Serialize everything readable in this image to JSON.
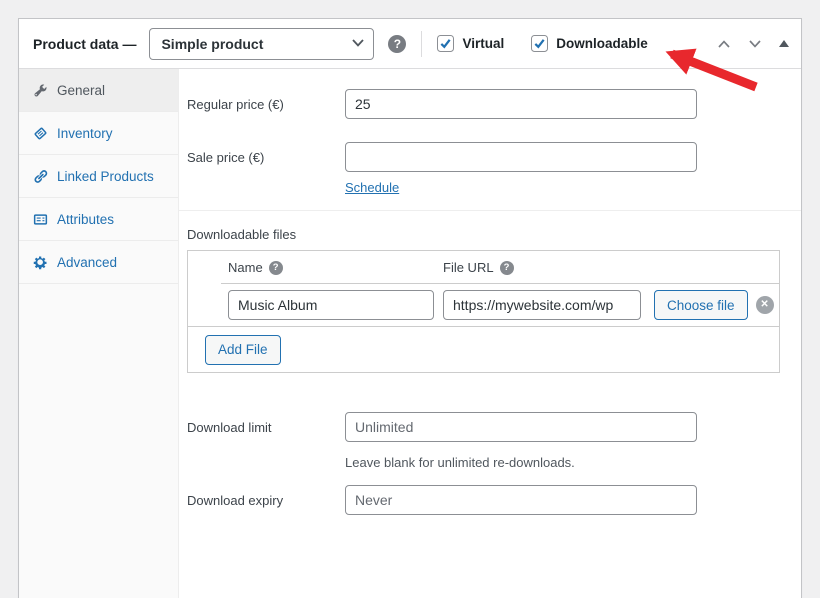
{
  "header": {
    "title": "Product data —",
    "product_type": {
      "value": "Simple product"
    },
    "checkboxes": [
      {
        "label": "Virtual",
        "checked": true
      },
      {
        "label": "Downloadable",
        "checked": true
      }
    ]
  },
  "sidebar": {
    "tabs": [
      {
        "label": "General",
        "icon": "wrench-icon",
        "active": true
      },
      {
        "label": "Inventory",
        "icon": "inventory-icon",
        "active": false
      },
      {
        "label": "Linked Products",
        "icon": "link-icon",
        "active": false
      },
      {
        "label": "Attributes",
        "icon": "attributes-card-icon",
        "active": false
      },
      {
        "label": "Advanced",
        "icon": "gear-icon",
        "active": false
      }
    ]
  },
  "pricing": {
    "regular_price_label": "Regular price (€)",
    "regular_price_value": "25",
    "sale_price_label": "Sale price (€)",
    "sale_price_value": "",
    "schedule_link": "Schedule"
  },
  "downloads": {
    "section_label": "Downloadable files",
    "table": {
      "name_header": "Name",
      "file_url_header": "File URL",
      "rows": [
        {
          "name": "Music Album",
          "file_url": "https://mywebsite.com/wp",
          "choose_file_label": "Choose file"
        }
      ],
      "add_file_label": "Add File"
    },
    "download_limit": {
      "label": "Download limit",
      "placeholder": "Unlimited",
      "help": "Leave blank for unlimited re-downloads."
    },
    "download_expiry": {
      "label": "Download expiry",
      "placeholder": "Never"
    }
  },
  "icons": {
    "help_glyph": "?",
    "dismiss_glyph": "✕"
  },
  "colors": {
    "accent": "#2271b1",
    "arrow_red": "#e8282d"
  }
}
